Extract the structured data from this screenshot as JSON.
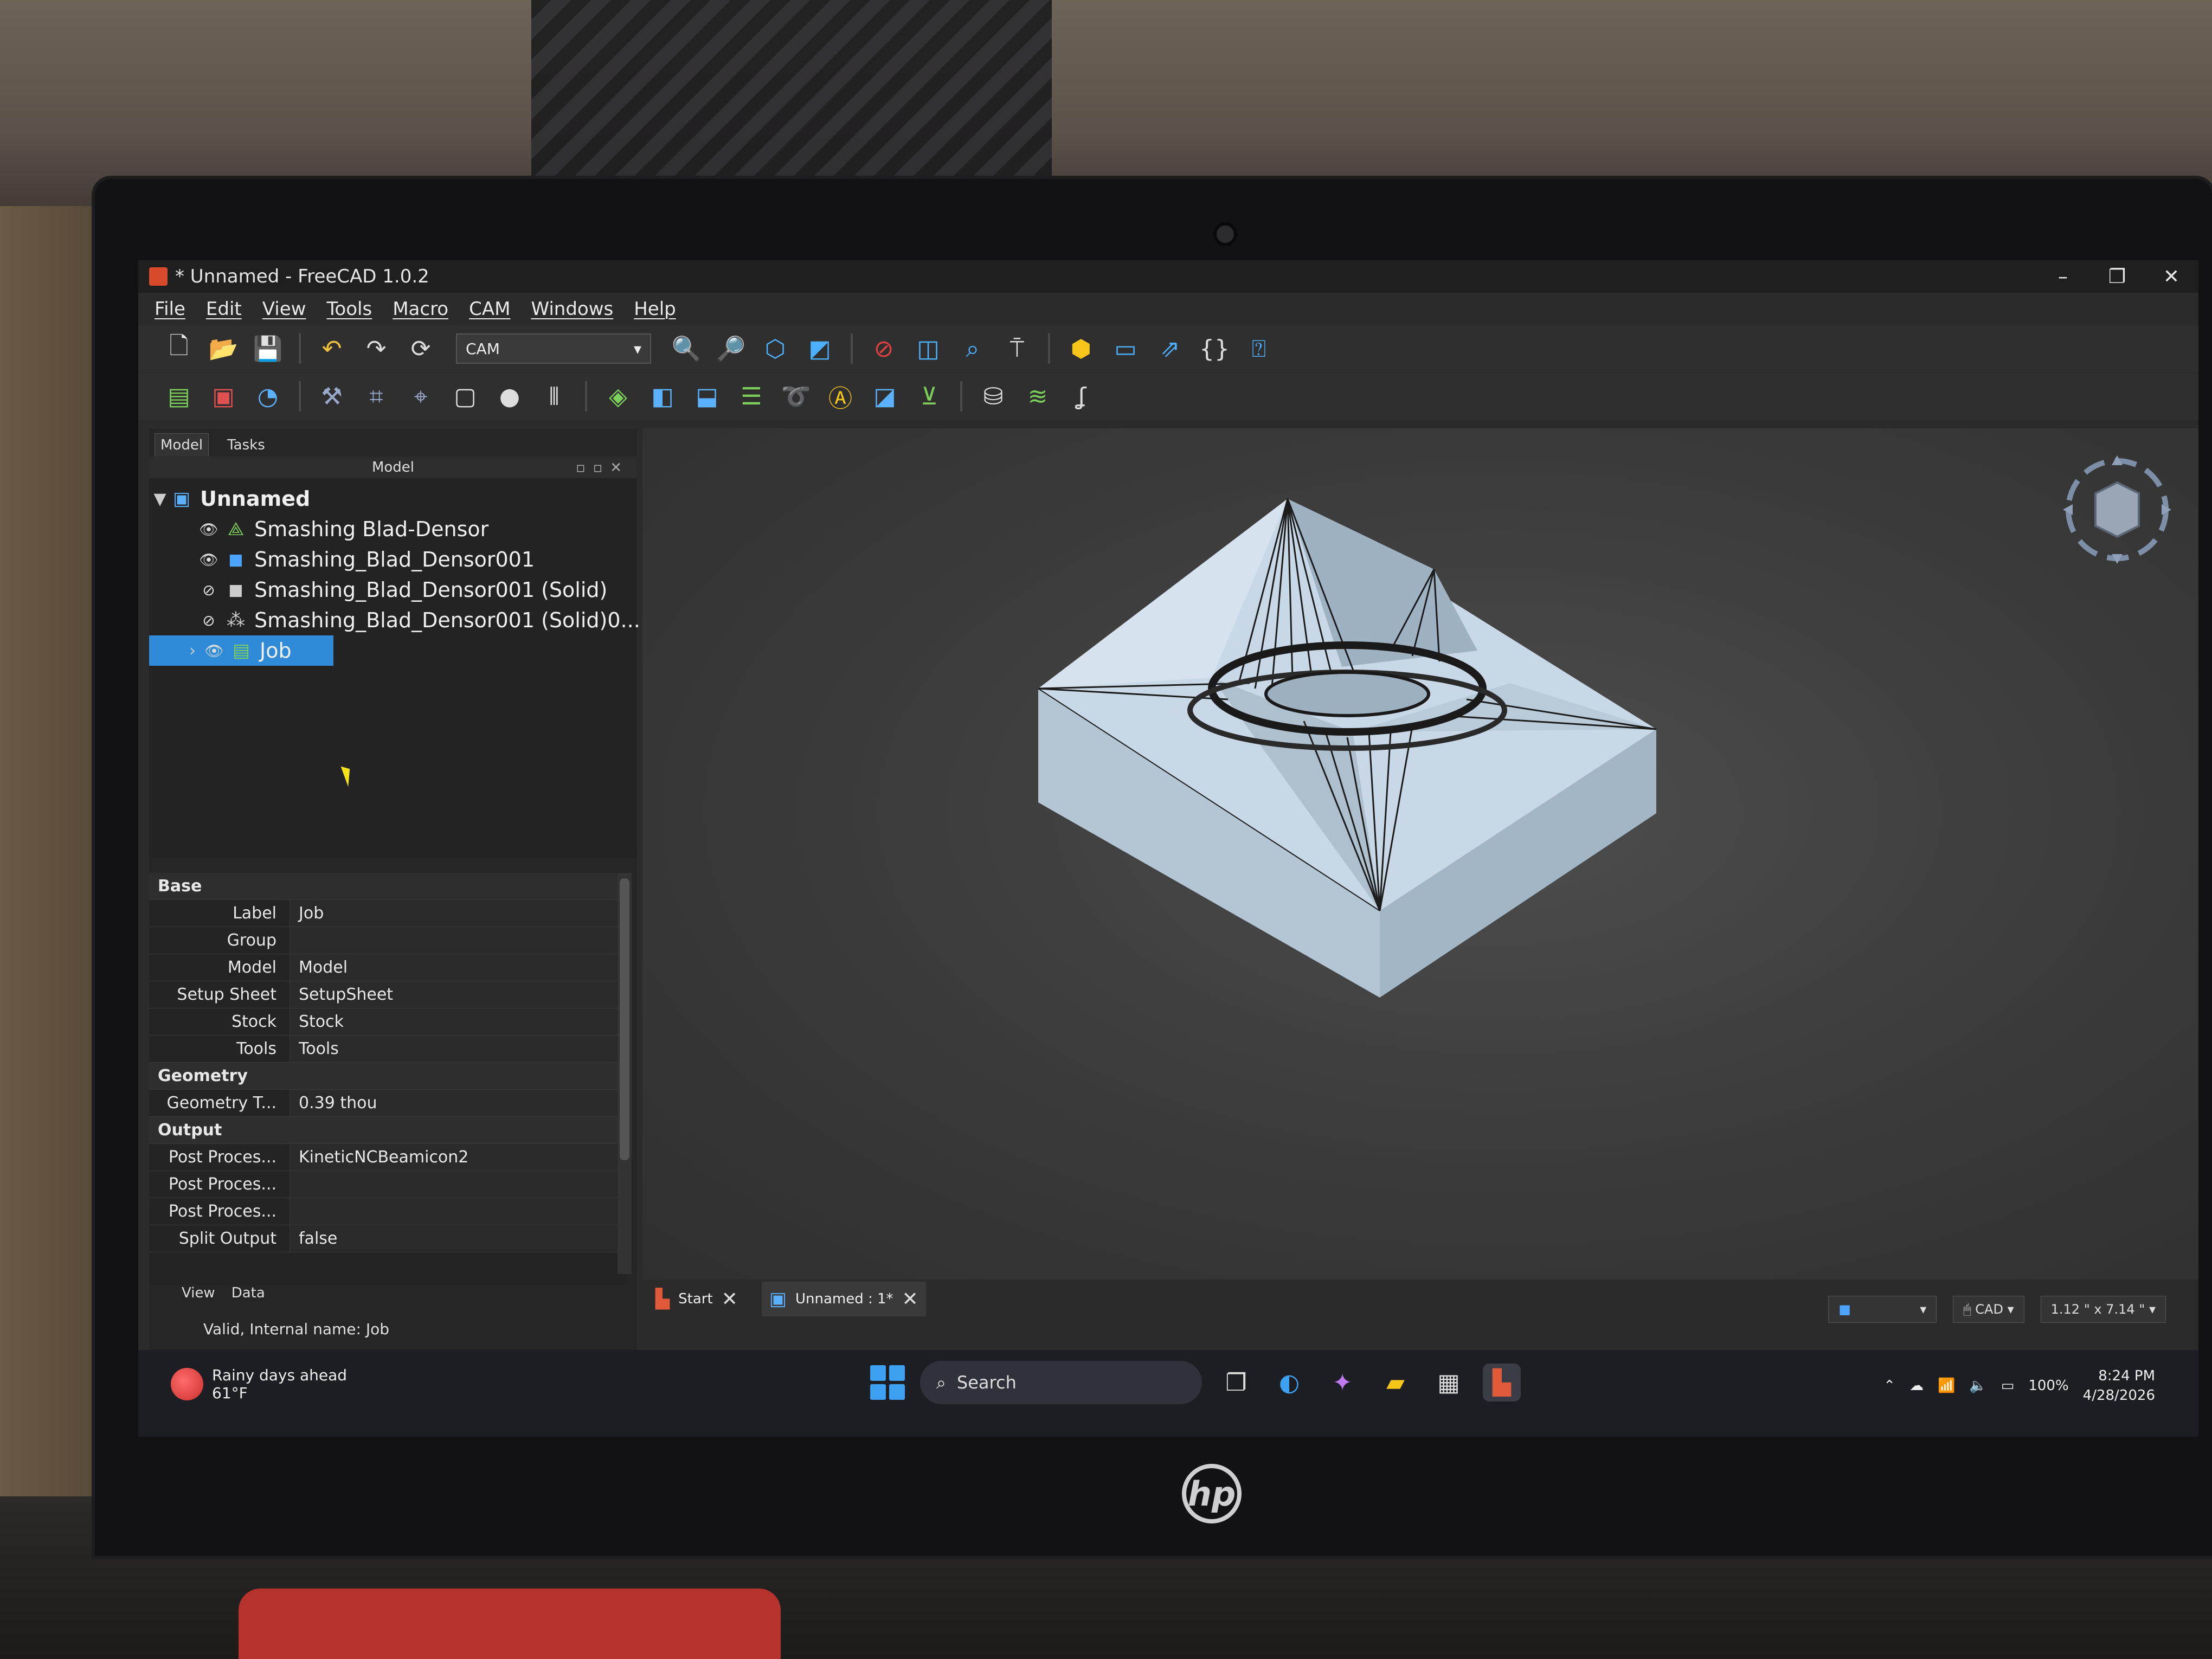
{
  "window": {
    "title": "* Unnamed - FreeCAD 1.0.2"
  },
  "menu": [
    "File",
    "Edit",
    "View",
    "Tools",
    "Macro",
    "CAM",
    "Windows",
    "Help"
  ],
  "toolbar": {
    "workbench": "CAM"
  },
  "panel_tabs": [
    "Model",
    "Tasks"
  ],
  "tree": {
    "header": "Model",
    "root": "Unnamed",
    "items": [
      "Smashing Blad-Densor",
      "Smashing_Blad_Densor001",
      "Smashing_Blad_Densor001 (Solid)",
      "Smashing_Blad_Densor001 (Solid)0...",
      "Job"
    ]
  },
  "properties": {
    "groups": [
      {
        "name": "Base",
        "rows": [
          {
            "name": "Label",
            "value": "Job"
          },
          {
            "name": "Group",
            "value": ""
          },
          {
            "name": "Model",
            "value": "Model"
          },
          {
            "name": "Setup Sheet",
            "value": "SetupSheet"
          },
          {
            "name": "Stock",
            "value": "Stock"
          },
          {
            "name": "Tools",
            "value": "Tools"
          }
        ]
      },
      {
        "name": "Geometry",
        "rows": [
          {
            "name": "Geometry T...",
            "value": "0.39 thou"
          }
        ]
      },
      {
        "name": "Output",
        "rows": [
          {
            "name": "Post Proces...",
            "value": "KineticNCBeamicon2"
          },
          {
            "name": "Post Proces...",
            "value": ""
          },
          {
            "name": "Post Proces...",
            "value": ""
          },
          {
            "name": "Split Output",
            "value": "false"
          }
        ]
      }
    ]
  },
  "bottom_tabs": [
    "View",
    "Data"
  ],
  "status_text": "Valid, Internal name: Job",
  "doc_tabs": [
    "Start",
    "Unnamed : 1*"
  ],
  "view_status": {
    "nav": "CAD",
    "dims": "1.12 \" x 7.14 \""
  },
  "taskbar": {
    "weather_text": "Rainy days ahead",
    "weather_temp": "61°F",
    "search": "Search",
    "battery": "100%",
    "time": "8:24 PM",
    "date": "4/28/2026"
  },
  "colors": {
    "selection": "#2f8bd8",
    "model_surface": "#c8d8e6",
    "viewport_bg": "#3a3a3a"
  }
}
